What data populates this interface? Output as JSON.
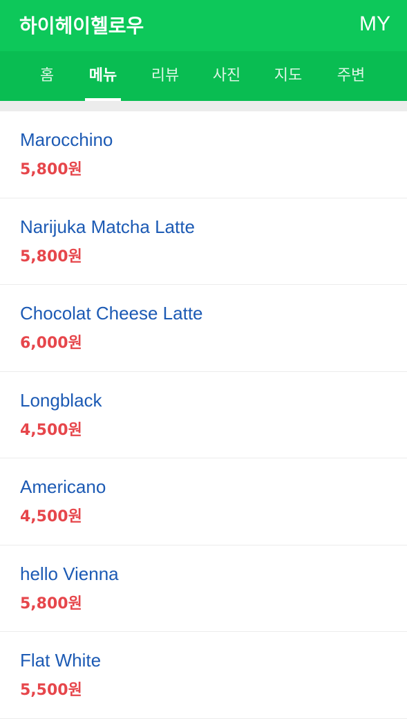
{
  "header": {
    "title": "하이헤이헬로우",
    "my_label": "MY"
  },
  "tabs": [
    {
      "label": "홈",
      "active": false
    },
    {
      "label": "메뉴",
      "active": true
    },
    {
      "label": "리뷰",
      "active": false
    },
    {
      "label": "사진",
      "active": false
    },
    {
      "label": "지도",
      "active": false
    },
    {
      "label": "주변",
      "active": false
    }
  ],
  "menu": [
    {
      "name": "Marocchino",
      "price": "5,800원"
    },
    {
      "name": "Narijuka Matcha Latte",
      "price": "5,800원"
    },
    {
      "name": "Chocolat Cheese Latte",
      "price": "6,000원"
    },
    {
      "name": "Longblack",
      "price": "4,500원"
    },
    {
      "name": "Americano",
      "price": "4,500원"
    },
    {
      "name": "hello Vienna",
      "price": "5,800원"
    },
    {
      "name": "Flat White",
      "price": "5,500원"
    }
  ],
  "colors": {
    "header_bg": "#0dc85a",
    "tabs_bg": "#09bd52",
    "item_name": "#1c5ab4",
    "price": "#e6464b"
  }
}
